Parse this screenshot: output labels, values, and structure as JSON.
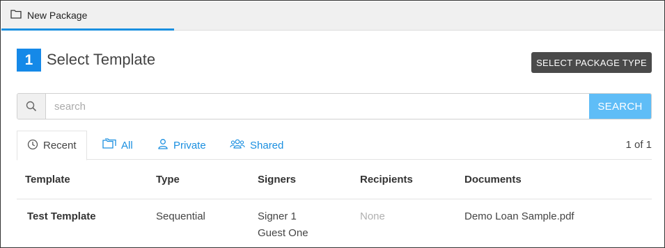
{
  "header": {
    "tab_label": "New Package",
    "tab_icon": "folder-icon"
  },
  "step": {
    "number": "1",
    "title": "Select Template",
    "badge_color": "#1589e8"
  },
  "actions": {
    "select_package_type_label": "SELECT PACKAGE TYPE"
  },
  "search": {
    "placeholder": "search",
    "value": "",
    "button_label": "SEARCH",
    "button_color": "#5fbdf7"
  },
  "filters": {
    "tabs": [
      {
        "label": "Recent",
        "icon": "clock-icon",
        "active": true
      },
      {
        "label": "All",
        "icon": "folders-icon",
        "active": false
      },
      {
        "label": "Private",
        "icon": "user-icon",
        "active": false
      },
      {
        "label": "Shared",
        "icon": "users-icon",
        "active": false
      }
    ],
    "page_count": "1 of 1"
  },
  "table": {
    "columns": [
      "Template",
      "Type",
      "Signers",
      "Recipients",
      "Documents"
    ],
    "rows": [
      {
        "template": "Test Template",
        "type": "Sequential",
        "signers": [
          "Signer 1",
          "Guest One"
        ],
        "recipients": "None",
        "documents": "Demo Loan Sample.pdf"
      }
    ]
  },
  "colors": {
    "accent": "#1a8fe0",
    "dark_button": "#4a4a4a"
  }
}
